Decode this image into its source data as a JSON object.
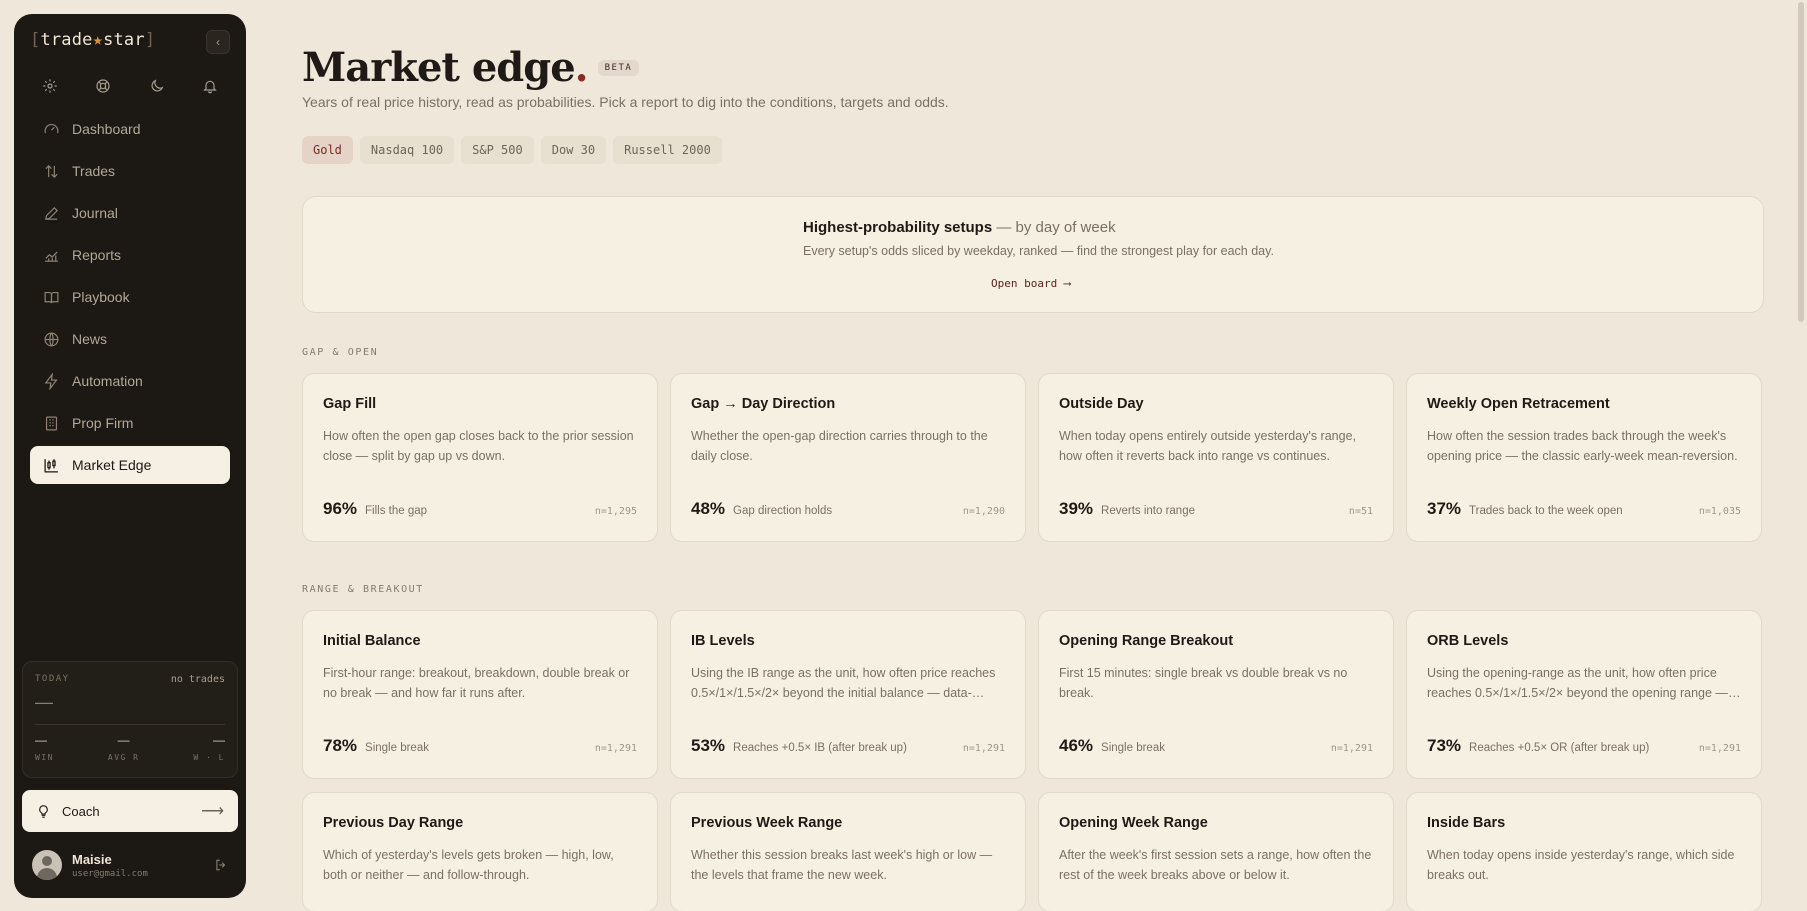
{
  "app": {
    "logo_open": "[",
    "logo_trade": "trade",
    "logo_star": "★",
    "logo_name": "star",
    "logo_close": "]",
    "collapse_glyph": "‹"
  },
  "sidebar": {
    "items": [
      {
        "label": "Dashboard",
        "icon": "gauge-icon"
      },
      {
        "label": "Trades",
        "icon": "arrows-up-down-icon"
      },
      {
        "label": "Journal",
        "icon": "pen-icon"
      },
      {
        "label": "Reports",
        "icon": "chart-line-icon"
      },
      {
        "label": "Playbook",
        "icon": "book-icon"
      },
      {
        "label": "News",
        "icon": "globe-icon"
      },
      {
        "label": "Automation",
        "icon": "bolt-icon"
      },
      {
        "label": "Prop Firm",
        "icon": "building-icon"
      },
      {
        "label": "Market Edge",
        "icon": "candlestick-icon",
        "active": true
      }
    ],
    "today": {
      "label": "TODAY",
      "status": "no trades",
      "pnl": "—",
      "stats": [
        {
          "value": "—",
          "key": "WIN"
        },
        {
          "value": "—",
          "key": "AVG R"
        },
        {
          "value": "—",
          "key": "W · L"
        }
      ]
    },
    "coach": {
      "label": "Coach",
      "arrow": "⟶"
    },
    "user": {
      "name": "Maisie",
      "email": "user@gmail.com"
    }
  },
  "header": {
    "title": "Market edge",
    "title_dot": ".",
    "badge": "BETA",
    "subtitle": "Years of real price history, read as probabilities. Pick a report to dig into the conditions, targets and odds."
  },
  "tabs": [
    {
      "label": "Gold",
      "active": true
    },
    {
      "label": "Nasdaq 100"
    },
    {
      "label": "S&P 500"
    },
    {
      "label": "Dow 30"
    },
    {
      "label": "Russell 2000"
    }
  ],
  "hero": {
    "title": "Highest-probability setups",
    "title_suffix": " — by day of week",
    "description": "Every setup's odds sliced by weekday, ranked — find the strongest play for each day.",
    "link": "Open board ⟶"
  },
  "sections": {
    "gap_open": "GAP & OPEN",
    "range_breakout": "RANGE & BREAKOUT"
  },
  "gap_cards": [
    {
      "title": "Gap Fill",
      "desc": "How often the open gap closes back to the prior session close — split by gap up vs down.",
      "pct": "96%",
      "label": "Fills the gap",
      "n": "n=1,295"
    },
    {
      "title": "Gap → Day Direction",
      "desc": "Whether the open-gap direction carries through to the daily close.",
      "pct": "48%",
      "label": "Gap direction holds",
      "n": "n=1,290"
    },
    {
      "title": "Outside Day",
      "desc": "When today opens entirely outside yesterday's range, how often it reverts back into range vs continues.",
      "pct": "39%",
      "label": "Reverts into range",
      "n": "n=51"
    },
    {
      "title": "Weekly Open Retracement",
      "desc": "How often the session trades back through the week's opening price — the classic early-week mean-reversion.",
      "pct": "37%",
      "label": "Trades back to the week open",
      "n": "n=1,035"
    }
  ],
  "range_cards": [
    {
      "title": "Initial Balance",
      "desc": "First-hour range: breakout, breakdown, double break or no break — and how far it runs after.",
      "pct": "78%",
      "label": "Single break",
      "n": "n=1,291"
    },
    {
      "title": "IB Levels",
      "desc": "Using the IB range as the unit, how often price reaches 0.5×/1×/1.5×/2× beyond the initial balance — data-driven targets.",
      "pct": "53%",
      "label": "Reaches +0.5× IB (after break up)",
      "n": "n=1,291"
    },
    {
      "title": "Opening Range Breakout",
      "desc": "First 15 minutes: single break vs double break vs no break.",
      "pct": "46%",
      "label": "Single break",
      "n": "n=1,291"
    },
    {
      "title": "ORB Levels",
      "desc": "Using the opening-range as the unit, how often price reaches 0.5×/1×/1.5×/2× beyond the opening range — data-driven targets.",
      "pct": "73%",
      "label": "Reaches +0.5× OR (after break up)",
      "n": "n=1,291"
    }
  ],
  "more_cards": [
    {
      "title": "Previous Day Range",
      "desc": "Which of yesterday's levels gets broken — high, low, both or neither — and follow-through."
    },
    {
      "title": "Previous Week Range",
      "desc": "Whether this session breaks last week's high or low — the levels that frame the new week."
    },
    {
      "title": "Opening Week Range",
      "desc": "After the week's first session sets a range, how often the rest of the week breaks above or below it."
    },
    {
      "title": "Inside Bars",
      "desc": "When today opens inside yesterday's range, which side breaks out."
    }
  ],
  "colors": {
    "background": "#efe8da",
    "sidebar": "#1c1813",
    "accent": "#8a2a22",
    "card": "#f6f0e3"
  }
}
